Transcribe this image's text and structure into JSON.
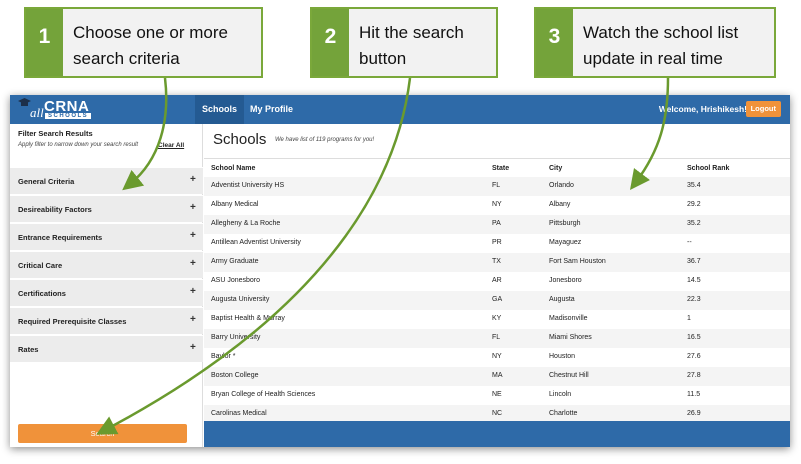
{
  "callouts": [
    {
      "number": "1",
      "line1": "Choose one or more",
      "line2": "search criteria"
    },
    {
      "number": "2",
      "line1": "Hit the search",
      "line2": "button"
    },
    {
      "number": "3",
      "line1": "Watch the school list",
      "line2": "update in real time"
    }
  ],
  "logo": {
    "all": "all",
    "crna": "CRNA",
    "schools": "SCHOOLS"
  },
  "nav": {
    "schools": "Schools",
    "profile": "My Profile"
  },
  "header": {
    "welcome": "Welcome, Hrishikesh!",
    "logout": "Logout"
  },
  "sidebar": {
    "title": "Filter Search Results",
    "subtitle": "Apply filter to narrow down your search result",
    "clear_all": "Clear All",
    "items": [
      {
        "label": "General Criteria",
        "icon": "+"
      },
      {
        "label": "Desireability Factors",
        "icon": "+"
      },
      {
        "label": "Entrance Requirements",
        "icon": "+"
      },
      {
        "label": "Critical Care",
        "icon": "+"
      },
      {
        "label": "Certifications",
        "icon": "+"
      },
      {
        "label": "Required Prerequisite Classes",
        "icon": "+"
      },
      {
        "label": "Rates",
        "icon": "+"
      }
    ],
    "search_label": "Search"
  },
  "main": {
    "title": "Schools",
    "subtitle": "We have list of 119 programs for you!",
    "columns": [
      "School Name",
      "State",
      "City",
      "School Rank"
    ],
    "rows": [
      [
        "Adventist University HS",
        "FL",
        "Orlando",
        "35.4"
      ],
      [
        "Albany Medical",
        "NY",
        "Albany",
        "29.2"
      ],
      [
        "Allegheny & La Roche",
        "PA",
        "Pittsburgh",
        "35.2"
      ],
      [
        "Antillean Adventist University",
        "PR",
        "Mayaguez",
        "--"
      ],
      [
        "Army Graduate",
        "TX",
        "Fort Sam Houston",
        "36.7"
      ],
      [
        "ASU Jonesboro",
        "AR",
        "Jonesboro",
        "14.5"
      ],
      [
        "Augusta University",
        "GA",
        "Augusta",
        "22.3"
      ],
      [
        "Baptist Health & Murray",
        "KY",
        "Madisonville",
        "1"
      ],
      [
        "Barry University",
        "FL",
        "Miami Shores",
        "16.5"
      ],
      [
        "Baylor *",
        "NY",
        "Houston",
        "27.6"
      ],
      [
        "Boston College",
        "MA",
        "Chestnut Hill",
        "27.8"
      ],
      [
        "Bryan College of Health Sciences",
        "NE",
        "Lincoln",
        "11.5"
      ],
      [
        "Carolinas Medical",
        "NC",
        "Charlotte",
        "26.9"
      ]
    ]
  },
  "colors": {
    "brand_blue": "#2e6aa8",
    "accent_orange": "#f0923a",
    "callout_green": "#74a33a"
  }
}
